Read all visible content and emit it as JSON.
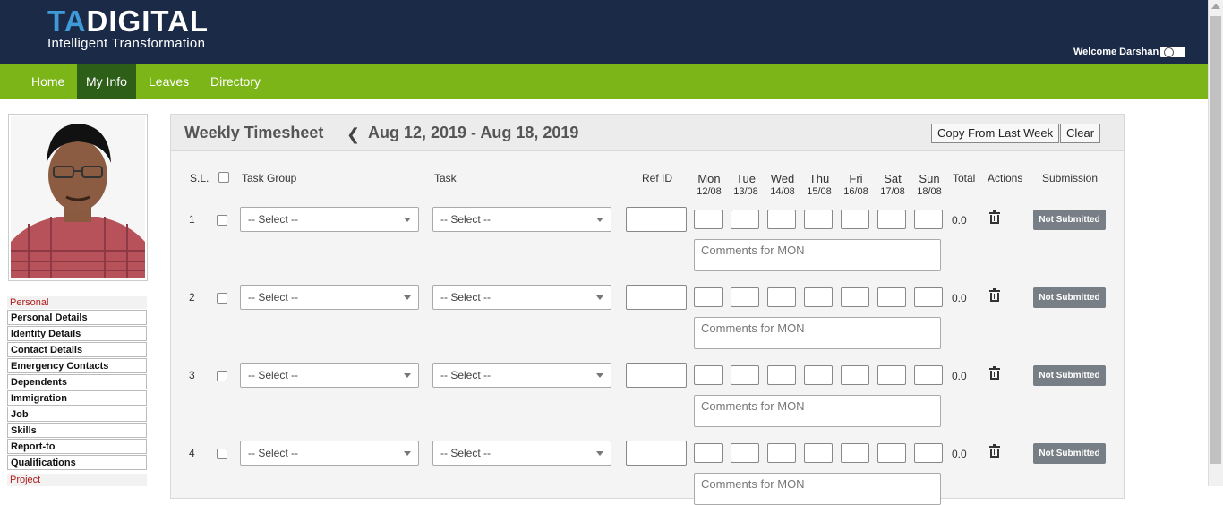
{
  "header": {
    "logo_ta": "TA",
    "logo_digital": "DIGITAL",
    "logo_tagline": "Intelligent Transformation",
    "welcome_text": "Welcome Darshan"
  },
  "nav": {
    "items": [
      {
        "label": "Home"
      },
      {
        "label": "My Info"
      },
      {
        "label": "Leaves"
      },
      {
        "label": "Directory"
      }
    ],
    "active": "My Info"
  },
  "sidebar": {
    "section_personal": "Personal",
    "items": [
      {
        "label": "Personal Details"
      },
      {
        "label": "Identity Details"
      },
      {
        "label": "Contact Details"
      },
      {
        "label": "Emergency Contacts"
      },
      {
        "label": "Dependents"
      },
      {
        "label": "Immigration"
      },
      {
        "label": "Job"
      },
      {
        "label": "Skills"
      },
      {
        "label": "Report-to"
      },
      {
        "label": "Qualifications"
      }
    ],
    "section_project": "Project"
  },
  "timesheet": {
    "title": "Weekly Timesheet",
    "date_range": "Aug 12, 2019 - Aug 18, 2019",
    "copy_button": "Copy From Last Week",
    "clear_button": "Clear",
    "columns": {
      "sl": "S.L.",
      "task_group": "Task Group",
      "task": "Task",
      "ref_id": "Ref ID",
      "total": "Total",
      "actions": "Actions",
      "submission": "Submission"
    },
    "days": [
      {
        "name": "Mon",
        "date": "12/08"
      },
      {
        "name": "Tue",
        "date": "13/08"
      },
      {
        "name": "Wed",
        "date": "14/08"
      },
      {
        "name": "Thu",
        "date": "15/08"
      },
      {
        "name": "Fri",
        "date": "16/08"
      },
      {
        "name": "Sat",
        "date": "17/08"
      },
      {
        "name": "Sun",
        "date": "18/08"
      }
    ],
    "rows": [
      {
        "num": "1",
        "task_group": "-- Select --",
        "task": "-- Select --",
        "total": "0.0",
        "status": "Not Submitted",
        "comments_placeholder": "Comments for MON"
      },
      {
        "num": "2",
        "task_group": "-- Select --",
        "task": "-- Select --",
        "total": "0.0",
        "status": "Not Submitted",
        "comments_placeholder": "Comments for MON"
      },
      {
        "num": "3",
        "task_group": "-- Select --",
        "task": "-- Select --",
        "total": "0.0",
        "status": "Not Submitted",
        "comments_placeholder": "Comments for MON"
      },
      {
        "num": "4",
        "task_group": "-- Select --",
        "task": "-- Select --",
        "total": "0.0",
        "status": "Not Submitted",
        "comments_placeholder": "Comments for MON"
      }
    ]
  },
  "colors": {
    "header_bg": "#1b2a46",
    "nav_bg": "#7cb518",
    "nav_active_bg": "#2e5f19",
    "badge_bg": "#777e85",
    "sidebar_heading": "#b01c1c"
  },
  "icons": {
    "prev_week": "chevron-left-icon",
    "delete": "trash-icon",
    "user": "user-icon"
  }
}
